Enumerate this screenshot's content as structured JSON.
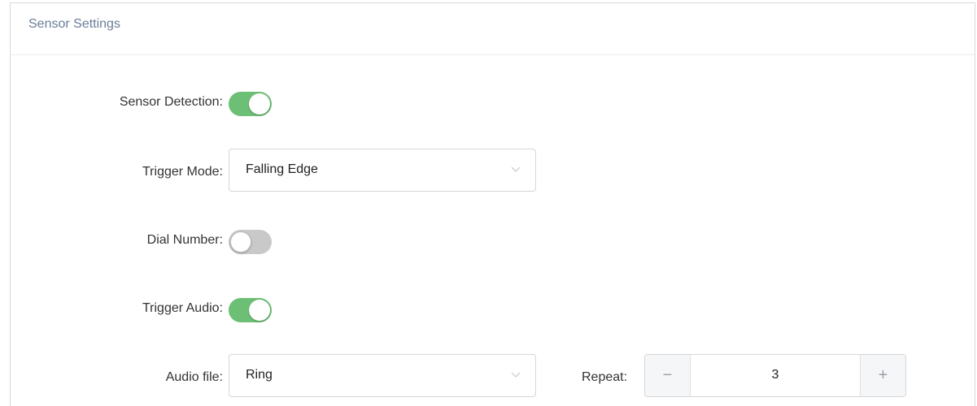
{
  "panel": {
    "title": "Sensor Settings"
  },
  "sensor_detection": {
    "label": "Sensor Detection:",
    "enabled": true
  },
  "trigger_mode": {
    "label": "Trigger Mode:",
    "value": "Falling Edge"
  },
  "dial_number": {
    "label": "Dial Number:",
    "enabled": false
  },
  "trigger_audio": {
    "label": "Trigger Audio:",
    "enabled": true
  },
  "audio_file": {
    "label": "Audio file:",
    "value": "Ring"
  },
  "repeat": {
    "label": "Repeat:",
    "value": "3",
    "minus": "−",
    "plus": "+"
  },
  "colors": {
    "toggle_on": "#6cbf75",
    "toggle_off": "#c9c9c9",
    "title": "#6a7d99"
  },
  "icons": {
    "select_arrow": "chevron-down-icon",
    "minus": "minus-icon",
    "plus": "plus-icon"
  }
}
